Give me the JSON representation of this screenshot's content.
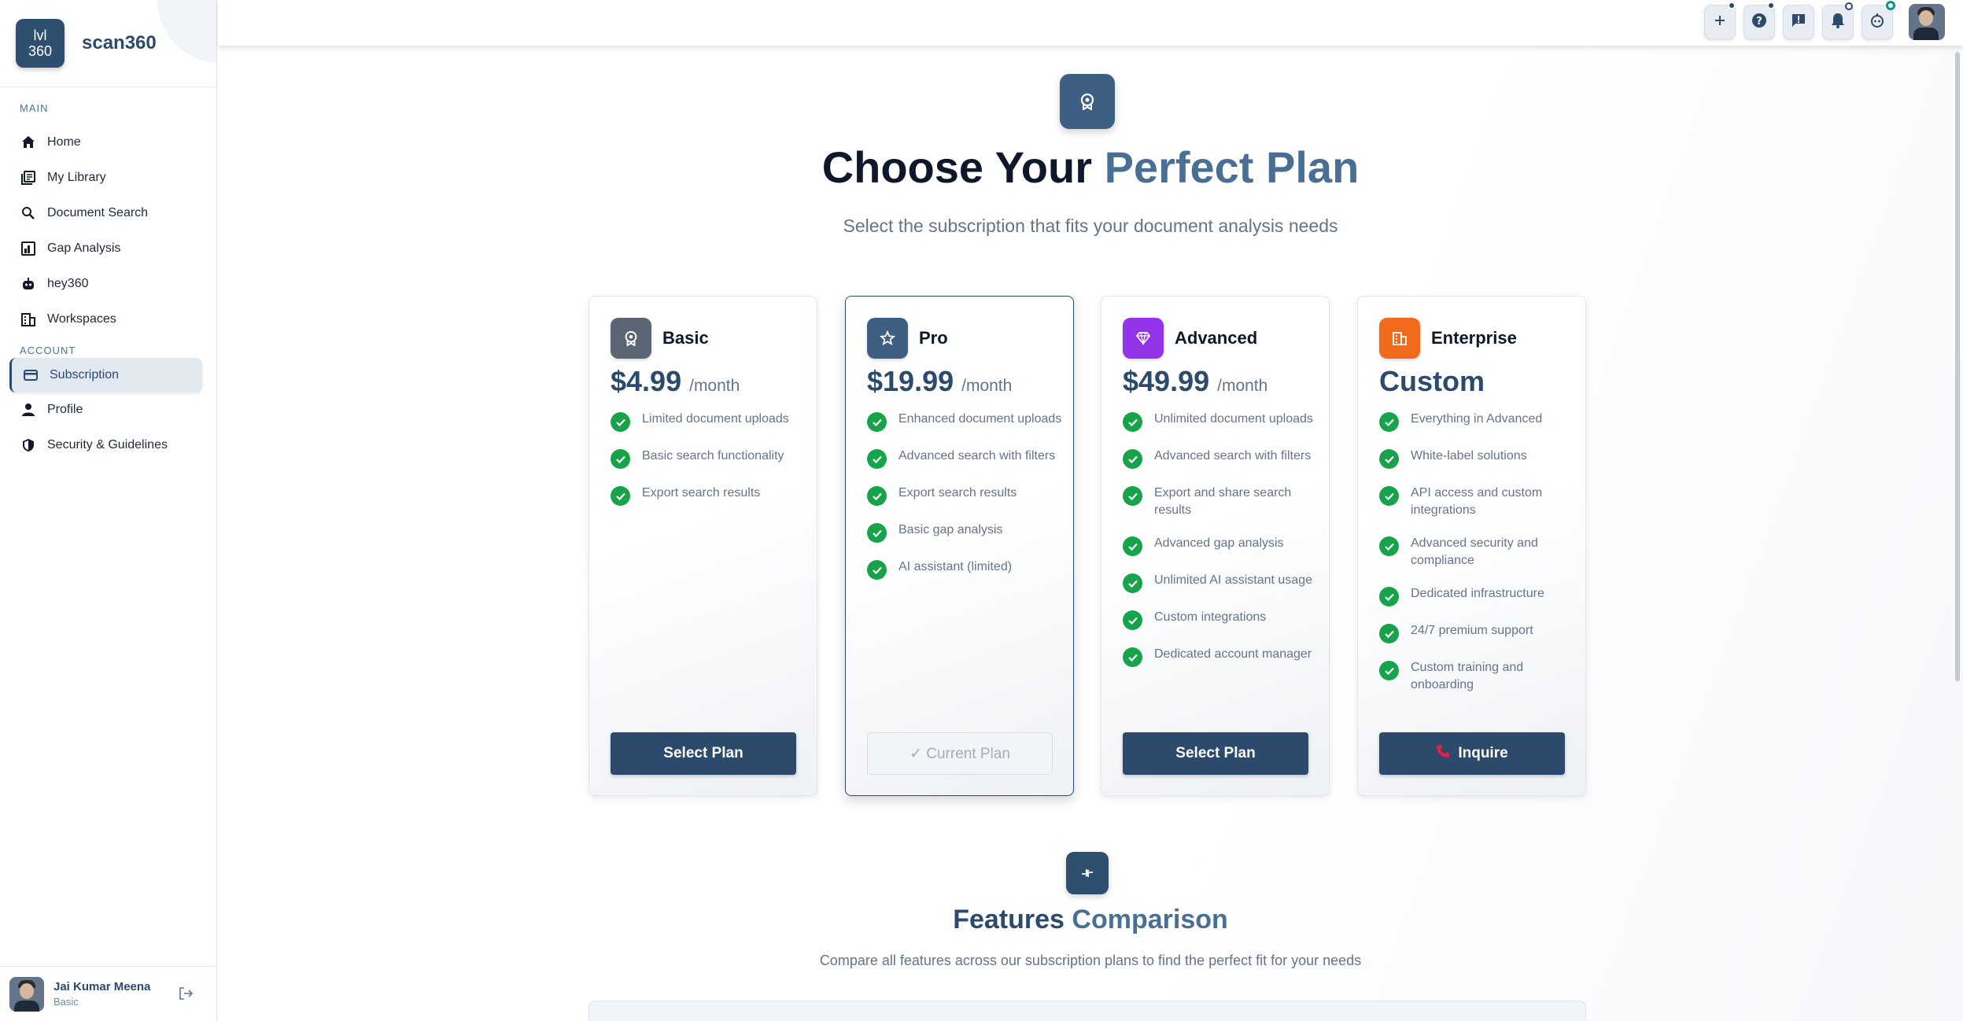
{
  "brand": {
    "logo_line1": "lvl",
    "logo_line2": "360",
    "name": "scan360"
  },
  "sidebar": {
    "main_label": "MAIN",
    "account_label": "ACCOUNT",
    "main_items": [
      {
        "label": "Home",
        "icon": "home-icon"
      },
      {
        "label": "My Library",
        "icon": "library-icon"
      },
      {
        "label": "Document Search",
        "icon": "search-icon"
      },
      {
        "label": "Gap Analysis",
        "icon": "gap-analysis-icon"
      },
      {
        "label": "hey360",
        "icon": "robot-icon"
      },
      {
        "label": "Workspaces",
        "icon": "building-icon"
      }
    ],
    "account_items": [
      {
        "label": "Subscription",
        "icon": "credit-card-icon",
        "active": true
      },
      {
        "label": "Profile",
        "icon": "user-icon"
      },
      {
        "label": "Security & Guidelines",
        "icon": "shield-icon"
      }
    ]
  },
  "user": {
    "name": "Jai Kumar Meena",
    "plan": "Basic"
  },
  "topbar": {
    "buttons": [
      "plus-icon",
      "help-icon",
      "feedback-icon",
      "bell-icon",
      "robot-icon"
    ]
  },
  "hero": {
    "title_part1": "Choose Your",
    "title_part2": "Perfect Plan",
    "subtitle": "Select the subscription that fits your document analysis needs"
  },
  "plans": [
    {
      "name": "Basic",
      "price": "$4.99",
      "period": "/month",
      "icon": "badge-icon",
      "icon_color": "#5b6573",
      "features": [
        "Limited document uploads",
        "Basic search functionality",
        "Export search results"
      ],
      "button": "Select Plan"
    },
    {
      "name": "Pro",
      "price": "$19.99",
      "period": "/month",
      "icon": "star-icon",
      "icon_color": "#3d5f84",
      "features": [
        "Enhanced document uploads",
        "Advanced search with filters",
        "Export search results",
        "Basic gap analysis",
        "AI assistant (limited)"
      ],
      "button": "✓ Current Plan",
      "current": true
    },
    {
      "name": "Advanced",
      "price": "$49.99",
      "period": "/month",
      "icon": "diamond-icon",
      "icon_color": "#9333ea",
      "features": [
        "Unlimited document uploads",
        "Advanced search with filters",
        "Export and share search results",
        "Advanced gap analysis",
        "Unlimited AI assistant usage",
        "Custom integrations",
        "Dedicated account manager"
      ],
      "button": "Select Plan"
    },
    {
      "name": "Enterprise",
      "price": "Custom",
      "period": "",
      "icon": "building-icon",
      "icon_color": "#f26b1d",
      "features": [
        "Everything in Advanced",
        "White-label solutions",
        "API access and custom integrations",
        "Advanced security and compliance",
        "Dedicated infrastructure",
        "24/7 premium support",
        "Custom training and onboarding"
      ],
      "button": "Inquire"
    }
  ],
  "comparison": {
    "title_part1": "Features",
    "title_part2": "Comparison",
    "subtitle": "Compare all features across our subscription plans to find the perfect fit for your needs"
  },
  "colors": {
    "brand": "#2c4a6b",
    "accent": "#4a6f94",
    "check": "#16a34a"
  }
}
